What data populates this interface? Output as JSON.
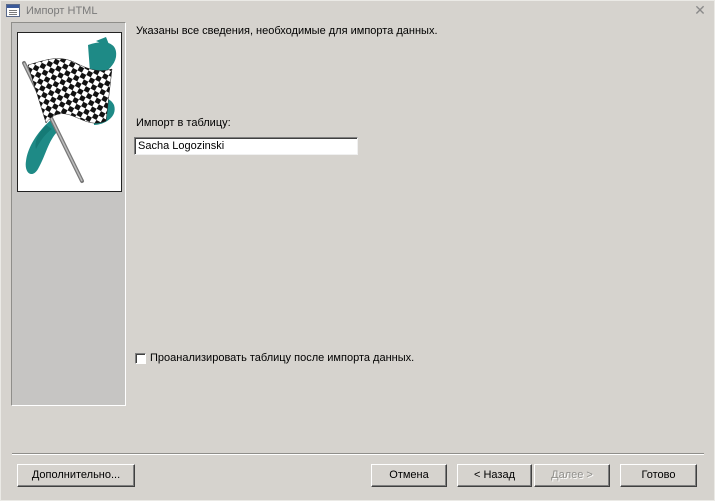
{
  "window": {
    "title": "Импорт HTML",
    "icon": "access-form-icon",
    "close_glyph": "✕"
  },
  "wizard": {
    "heading": "Указаны все сведения, необходимые для импорта данных.",
    "import_label": "Импорт в таблицу:",
    "table_name": "Sacha Logozinski",
    "analyze_checkbox_label": "Проанализировать таблицу после импорта данных.",
    "analyze_checked": false,
    "picture": "checkered-flag-icon"
  },
  "buttons": {
    "advanced": "Дополнительно...",
    "cancel": "Отмена",
    "back": "< Назад",
    "next": "Далее >",
    "finish": "Готово"
  },
  "colors": {
    "window_bg": "#d6d3ce",
    "panel_bg": "#c6c5c3",
    "flag_accent": "#1e8a86"
  }
}
